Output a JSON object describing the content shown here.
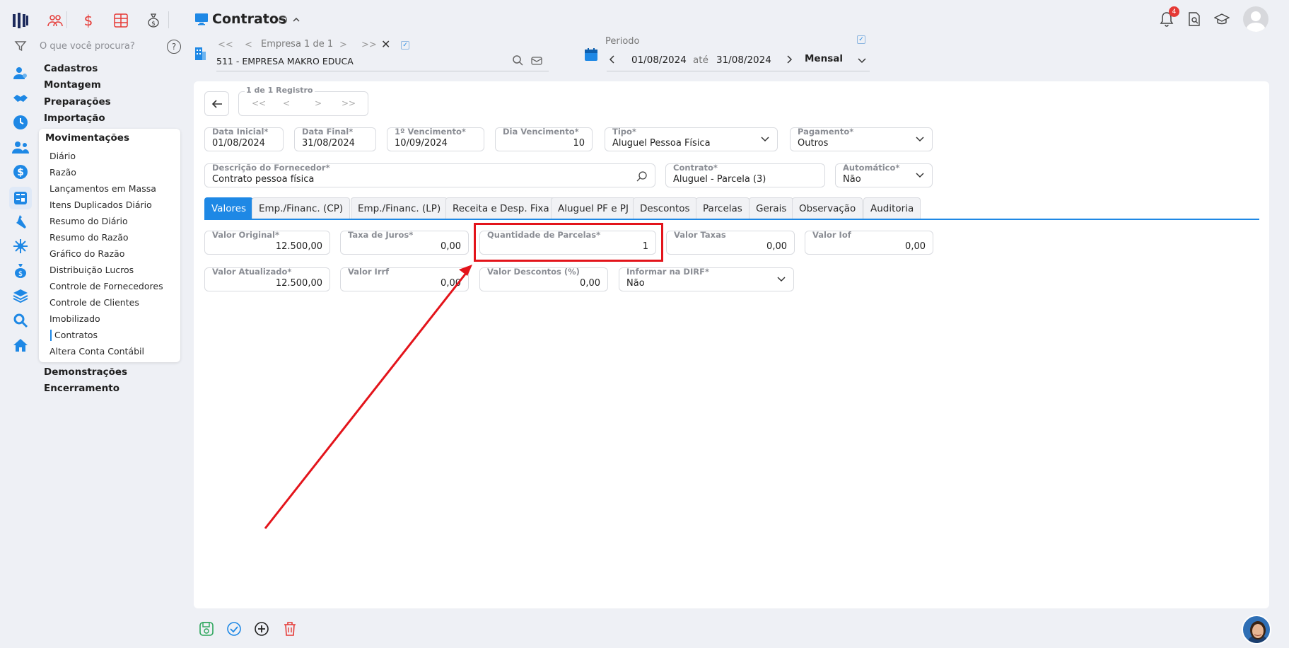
{
  "header": {
    "title": "Contratos"
  },
  "search": {
    "placeholder": "O que você procura?"
  },
  "company": {
    "nav_label": "Empresa 1 de 1",
    "name": "511 - EMPRESA MAKRO EDUCA"
  },
  "period": {
    "label": "Periodo",
    "start": "01/08/2024",
    "sep": "até",
    "end": "31/08/2024",
    "mode": "Mensal"
  },
  "notifications": {
    "count": "4"
  },
  "nav": {
    "groups": [
      "Cadastros",
      "Montagem",
      "Preparações",
      "Importação",
      "Movimentações",
      "Demonstrações",
      "Encerramento"
    ],
    "sub_items": [
      "Diário",
      "Razão",
      "Lançamentos em Massa",
      "Itens Duplicados Diário",
      "Resumo do Diário",
      "Resumo do Razão",
      "Gráfico do Razão",
      "Distribuição Lucros",
      "Controle de Fornecedores",
      "Controle de Clientes",
      "Imobilizado",
      "Contratos",
      "Altera Conta Contábil"
    ]
  },
  "record": {
    "label": "1 de 1 Registro"
  },
  "form": {
    "data_inicial": {
      "label": "Data Inicial*",
      "value": "01/08/2024"
    },
    "data_final": {
      "label": "Data Final*",
      "value": "31/08/2024"
    },
    "vencimento1": {
      "label": "1º Vencimento*",
      "value": "10/09/2024"
    },
    "dia_vencimento": {
      "label": "Dia Vencimento*",
      "value": "10"
    },
    "tipo": {
      "label": "Tipo*",
      "value": "Aluguel Pessoa Física"
    },
    "pagamento": {
      "label": "Pagamento*",
      "value": "Outros"
    },
    "descricao": {
      "label": "Descrição do Fornecedor*",
      "value": "Contrato pessoa física"
    },
    "contrato": {
      "label": "Contrato*",
      "value": "Aluguel - Parcela (3)"
    },
    "automatico": {
      "label": "Automático*",
      "value": "Não"
    }
  },
  "tabs": [
    "Valores",
    "Emp./Financ. (CP)",
    "Emp./Financ. (LP)",
    "Receita e Desp. Fixa",
    "Aluguel PF e PJ",
    "Descontos",
    "Parcelas",
    "Gerais",
    "Observação",
    "Auditoria"
  ],
  "valores": {
    "valor_original": {
      "label": "Valor Original*",
      "value": "12.500,00"
    },
    "taxa_juros": {
      "label": "Taxa de Juros*",
      "value": "0,00"
    },
    "qtd_parcelas": {
      "label": "Quantidade de Parcelas*",
      "value": "1"
    },
    "valor_taxas": {
      "label": "Valor Taxas",
      "value": "0,00"
    },
    "valor_iof": {
      "label": "Valor Iof",
      "value": "0,00"
    },
    "valor_atualizado": {
      "label": "Valor Atualizado*",
      "value": "12.500,00"
    },
    "valor_irrf": {
      "label": "Valor Irrf",
      "value": "0,00"
    },
    "valor_descontos": {
      "label": "Valor Descontos (%)",
      "value": "0,00"
    },
    "informar_dirf": {
      "label": "Informar na DIRF*",
      "value": "Não"
    }
  },
  "colors": {
    "accent": "#1e88e5",
    "highlight": "#e3141b",
    "danger": "#e53935",
    "success": "#2aa55a"
  }
}
